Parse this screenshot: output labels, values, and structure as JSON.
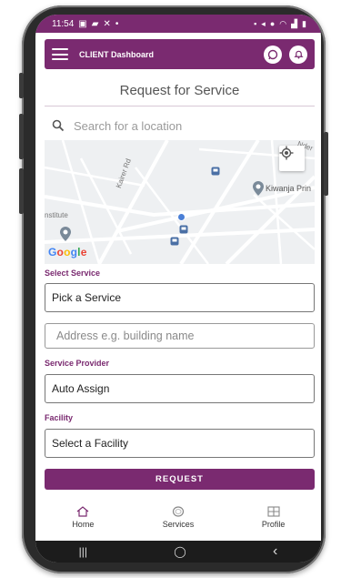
{
  "status_bar": {
    "time": "11:54",
    "notification_icons": [
      "gallery-icon",
      "message-icon",
      "fan-icon",
      "dot-icon"
    ],
    "system_icons": [
      "lock-icon",
      "mute-icon",
      "location-icon",
      "wifi-icon",
      "signal-icon",
      "battery-icon"
    ]
  },
  "app_bar": {
    "title": "CLIENT Dashboard",
    "menu_icon": "menu-icon",
    "actions": [
      "whatsapp-icon",
      "bell-icon"
    ]
  },
  "page": {
    "heading": "Request for Service"
  },
  "search": {
    "placeholder": "Search for a location"
  },
  "map": {
    "labels": {
      "road": "Kairer Rd",
      "corner": "Nder",
      "institute": "nstitute",
      "poi": "Kiwanja Prin"
    },
    "brand": "Google",
    "locate_icon": "my-location-icon"
  },
  "form": {
    "service_label": "Select Service",
    "service_value": "Pick a Service",
    "address_placeholder": "Address e.g. building name",
    "provider_label": "Service Provider",
    "provider_value": "Auto Assign",
    "facility_label": "Facility",
    "facility_value": "Select a Facility",
    "submit_label": "REQUEST"
  },
  "bottom_nav": {
    "items": [
      {
        "label": "Home",
        "icon": "home-icon"
      },
      {
        "label": "Services",
        "icon": "services-icon"
      },
      {
        "label": "Profile",
        "icon": "profile-icon"
      }
    ]
  },
  "system_nav": {
    "recents": "|||",
    "home": "◯",
    "back": "‹"
  },
  "colors": {
    "brand": "#7a2a70",
    "map_background": "#eef0f2",
    "location_dot": "#4a7fd6"
  }
}
